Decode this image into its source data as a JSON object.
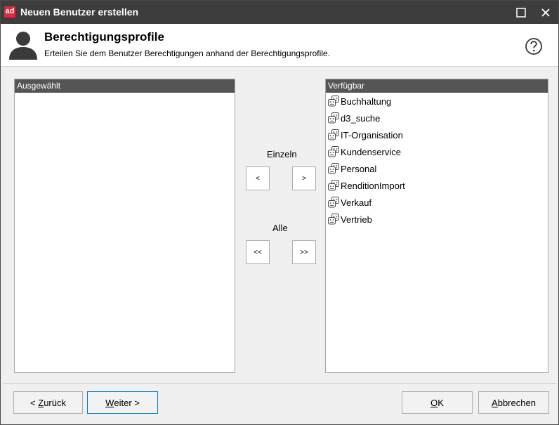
{
  "window": {
    "logo_text": "ad",
    "title": "Neuen Benutzer erstellen"
  },
  "header": {
    "title": "Berechtigungsprofile",
    "subtitle": "Erteilen Sie dem Benutzer Berechtigungen anhand der Berechtigungsprofile."
  },
  "selected_list": {
    "header": "Ausgewählt",
    "items": []
  },
  "available_list": {
    "header": "Verfügbar",
    "items": [
      "Buchhaltung",
      "d3_suche",
      "IT-Organisation",
      "Kundenservice",
      "Personal",
      "RenditionImport",
      "Verkauf",
      "Vertrieb"
    ]
  },
  "move": {
    "single_label": "Einzeln",
    "single_left": "<",
    "single_right": ">",
    "all_label": "Alle",
    "all_left": "<<",
    "all_right": ">>"
  },
  "footer": {
    "back_prefix": "< ",
    "back_mnemonic": "Z",
    "back_rest": "urück",
    "next_mnemonic": "W",
    "next_rest": "eiter >",
    "ok_mnemonic": "O",
    "ok_rest": "K",
    "cancel_mnemonic": "A",
    "cancel_rest": "bbrechen"
  },
  "colors": {
    "title_bar": "#3d3d3d",
    "list_header": "#555555",
    "logo": "#e3263a",
    "focus_border": "#0078d7"
  }
}
